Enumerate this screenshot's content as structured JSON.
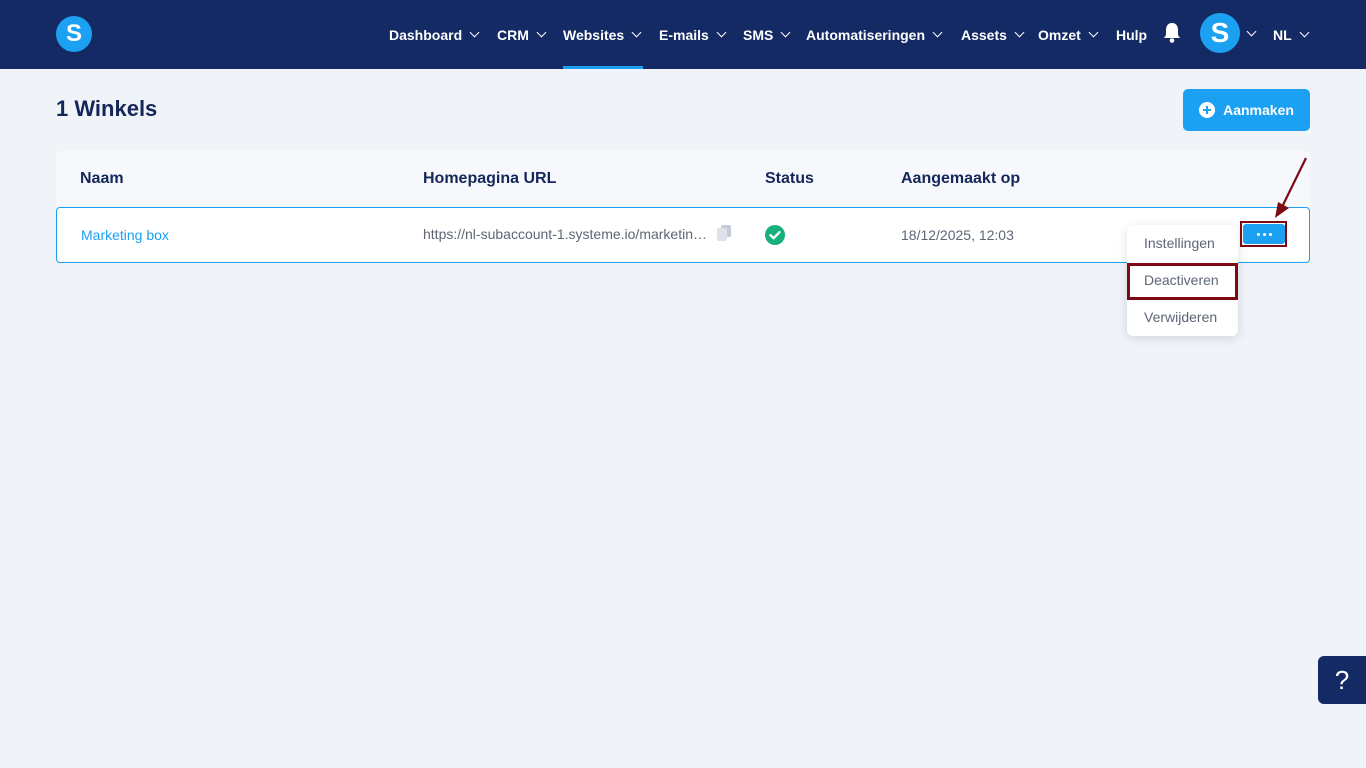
{
  "brand": {
    "logo_letter": "S"
  },
  "nav": {
    "items": [
      {
        "label": "Dashboard"
      },
      {
        "label": "CRM"
      },
      {
        "label": "Websites"
      },
      {
        "label": "E-mails"
      },
      {
        "label": "SMS"
      },
      {
        "label": "Automatiseringen"
      },
      {
        "label": "Assets"
      },
      {
        "label": "Omzet"
      },
      {
        "label": "Hulp"
      }
    ],
    "active": "Websites",
    "avatar_letter": "S",
    "language": "NL"
  },
  "page": {
    "title": "1 Winkels",
    "create_label": "Aanmaken"
  },
  "table": {
    "headers": [
      "Naam",
      "Homepagina URL",
      "Status",
      "Aangemaakt op"
    ],
    "rows": [
      {
        "name": "Marketing box",
        "url": "https://nl-subaccount-1.systeme.io/marketing-box",
        "status": "active",
        "created": "18/12/2025, 12:03"
      }
    ]
  },
  "menu": {
    "items": [
      "Instellingen",
      "Deactiveren",
      "Verwijderen"
    ],
    "highlighted": "Deactiveren"
  },
  "help": {
    "label": "?"
  },
  "colors": {
    "nav_bg": "#142a64",
    "accent": "#1ba0f2",
    "success": "#16b07a",
    "highlight": "#7d0a12",
    "page_bg": "#f0f3f8"
  }
}
